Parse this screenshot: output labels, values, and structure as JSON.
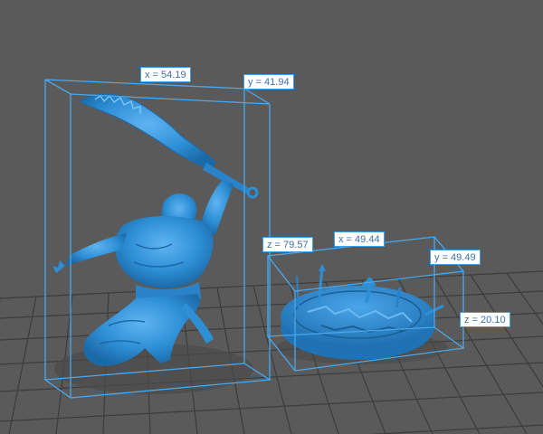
{
  "colors": {
    "background": "#5a5a5a",
    "grid_line": "#3c3c3c",
    "model": "#2e8fd6",
    "model_shadow": "#1f6fae",
    "bounding_box": "#49a8ee",
    "label_text": "#3b6fb0"
  },
  "figure": {
    "bbox_labels": {
      "x": "x = 54.19",
      "y": "y = 41.94"
    }
  },
  "base": {
    "bbox_labels": {
      "z": "z = 79.57",
      "x": "x = 49.44",
      "y": "y = 49.49",
      "z_height": "z = 20.10"
    }
  }
}
